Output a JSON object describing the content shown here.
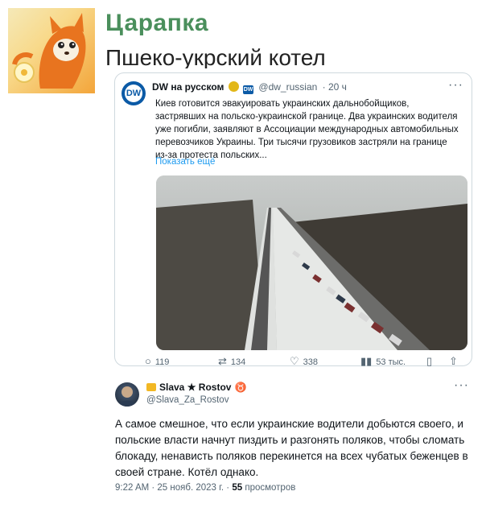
{
  "site": {
    "title": "Царапка"
  },
  "post": {
    "title": "Пшеко-укрский котел"
  },
  "quoted_tweet": {
    "author_name": "DW на русском",
    "affiliation_badge": "DW",
    "handle": "@dw_russian",
    "time": "· 20 ч",
    "text": "Киев готовится эвакуировать украинских дальнобойщиков, застрявших на польско-украинской границе. Два украинских водителя уже погибли, заявляют в Ассоциации международных автомобильных перевозчиков Украины. Три тысячи грузовиков застряли на границе из-за протеста польских...",
    "show_more": "Показать ещё",
    "more": "···",
    "stats": {
      "replies": "119",
      "retweets": "134",
      "likes": "338",
      "views": "53 тыс."
    }
  },
  "reply": {
    "author_name": "Slava ★ Rostov",
    "handle": "@Slava_Za_Rostov",
    "more": "···",
    "text": "А самое смешное, что если украинские водители добьются своего, и польские власти начнут пиздить и разгонять поляков, чтобы сломать блокаду, ненависть поляков перекинется на всех чубатых беженцев в своей стране. Котёл однако.",
    "time": "9:22 AM · 25 нояб. 2023 г. ·",
    "views_count": "55",
    "views_label": "просмотров"
  },
  "icons": {
    "reply": "reply-icon",
    "retweet": "retweet-icon",
    "like": "heart-icon",
    "views": "views-icon",
    "bookmark": "bookmark-icon",
    "share": "share-icon"
  },
  "colors": {
    "accent": "#1d9bf0",
    "site_title": "#4a8f5c",
    "dw_blue": "#0b5aa6",
    "verified_gold": "#e2b719"
  }
}
